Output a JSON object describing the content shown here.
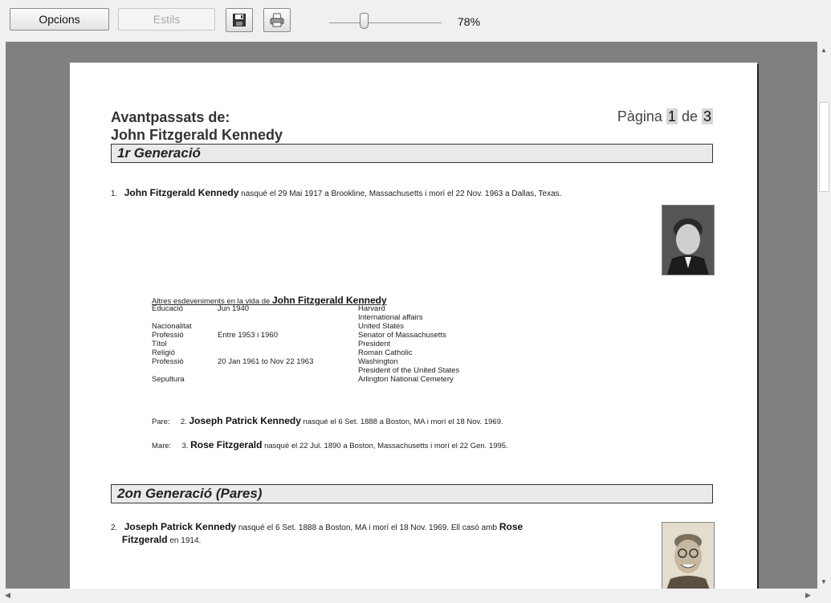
{
  "toolbar": {
    "options_label": "Opcions",
    "styles_label": "Estils",
    "save_icon": "save-icon",
    "print_icon": "printer-icon",
    "zoom": "78%",
    "zoom_value": 78
  },
  "page": {
    "title_line1": "Avantpassats de:",
    "title_line2": "John Fitzgerald Kennedy",
    "page_label": "Pàgina",
    "page_current": "1",
    "page_of": "de",
    "page_total": "3"
  },
  "gen1": {
    "heading": "1r Generació",
    "number": "1.",
    "name": "John Fitzgerald Kennedy",
    "text": " nasqué el 29 Mai 1917 a Brookline, Massachusetts i morí el 22 Nov. 1963 a Dallas, Texas.",
    "events_heading": "Altres esdeveniments en la vida de",
    "events_name": "John Fitzgerald Kennedy",
    "events": [
      {
        "type": "Educació",
        "date": "Jun 1940",
        "desc": "Harvard"
      },
      {
        "type": "",
        "date": "",
        "desc": "International affairs"
      },
      {
        "type": "Nacionalitat",
        "date": "",
        "desc": "United States"
      },
      {
        "type": "Professió",
        "date": "Entre 1953 i 1960",
        "desc": "Senator of Massachusetts"
      },
      {
        "type": "Títol",
        "date": "",
        "desc": "President"
      },
      {
        "type": "Religió",
        "date": "",
        "desc": "Roman Catholic"
      },
      {
        "type": "Professió",
        "date": "20 Jan 1961 to Nov 22 1963",
        "desc": "Washington"
      },
      {
        "type": "",
        "date": "",
        "desc": "President of the United States"
      },
      {
        "type": "Sepultura",
        "date": "",
        "desc": "Arlington National Cemetery"
      }
    ],
    "father_label": "Pare:",
    "father_num": "2.",
    "father_name": "Joseph Patrick Kennedy",
    "father_text": " nasqué el 6 Set. 1888 a Boston, MA i morí el 18 Nov. 1969.",
    "mother_label": "Mare:",
    "mother_num": "3.",
    "mother_name": "Rose Fitzgerald",
    "mother_text": " nasqué el 22 Jul. 1890 a Boston, Massachusetts i morí el 22 Gen. 1995."
  },
  "gen2": {
    "heading": "2on Generació (Pares)",
    "number": "2.",
    "name": "Joseph Patrick Kennedy",
    "text": " nasqué el 6 Set. 1888 a Boston, MA i morí el 18 Nov. 1969. Ell casó amb ",
    "spouse": "Rose",
    "spouse2": "Fitzgerald",
    "text2": " en 1914."
  },
  "colors": {
    "viewport_bg": "#808080",
    "genbar_bg": "#eaeaea"
  }
}
